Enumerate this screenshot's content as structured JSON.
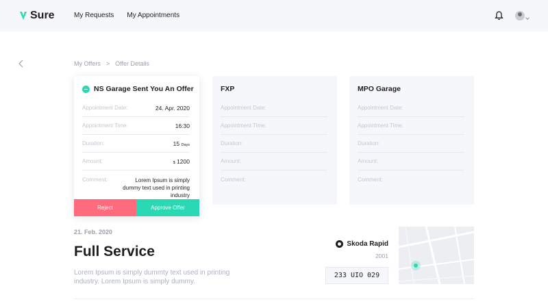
{
  "header": {
    "logo_text": "Sure",
    "nav": [
      "My Requests",
      "My Appointments"
    ],
    "icons": {
      "bell": "bell-icon",
      "avatar": "user-avatar"
    }
  },
  "breadcrumb": {
    "items": [
      "My Offers",
      "Offer Details"
    ],
    "separator": ">"
  },
  "offers": [
    {
      "title": "NS Garage Sent You An Offer",
      "labels": {
        "date": "Appointment Date:",
        "time": "Appointment Time:",
        "duration": "Duration:",
        "amount": "Amount:",
        "comment": "Comment:"
      },
      "date": "24. Apr. 2020",
      "time": "16:30",
      "duration_value": "15",
      "duration_unit": "Days",
      "amount_currency": "$",
      "amount_value": "1200",
      "comment": "Lorem Ipsum is simply dummy text used in printing industry",
      "reject_label": "Reject",
      "approve_label": "Approve Offer"
    },
    {
      "title": "FXP",
      "labels": {
        "date": "Appointment Date:",
        "time": "Appointment Time:",
        "duration": "Duration:",
        "amount": "Amount:",
        "comment": "Comment:"
      }
    },
    {
      "title": "MPO Garage",
      "labels": {
        "date": "Appointment Date:",
        "time": "Appointment Time:",
        "duration": "Duration:",
        "amount": "Amount:",
        "comment": "Comment:"
      }
    }
  ],
  "service": {
    "date": "21. Feb. 2020",
    "title": "Full Service",
    "description": "Lorem Ipsum is simply dummty text used in printing industry. Lorem Ipsum is simply dummy."
  },
  "vehicle": {
    "name": "Skoda Rapid",
    "year": "2001",
    "plate": "233 UIO 029"
  },
  "colors": {
    "accent": "#2ad9b3",
    "reject": "#fd6b7c",
    "muted": "#9aa0ad",
    "panel": "#f6f7fb"
  }
}
